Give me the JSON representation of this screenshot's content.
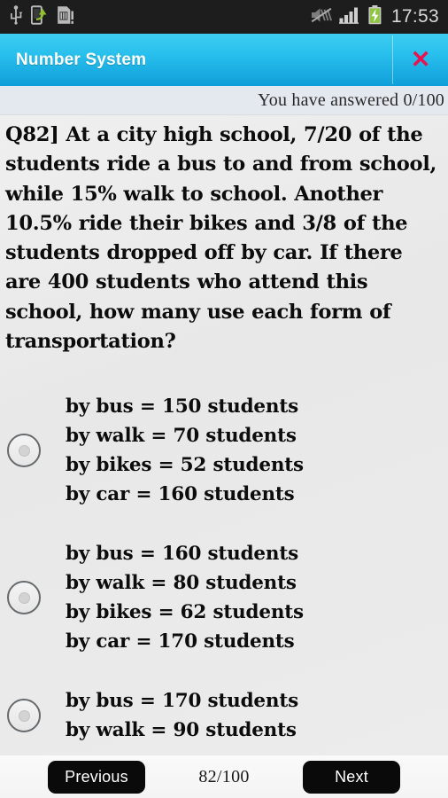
{
  "statusbar": {
    "time": "17:53",
    "icons": [
      {
        "name": "usb-icon"
      },
      {
        "name": "phone-transfer-icon"
      },
      {
        "name": "sd-card-alert-icon"
      },
      {
        "name": "mute-vibrate-off-icon"
      },
      {
        "name": "signal-bars-icon"
      },
      {
        "name": "battery-charging-icon"
      }
    ],
    "background_color": "#1d1d1d",
    "text_color": "#d8d8d8"
  },
  "titlebar": {
    "title": "Number System",
    "close_label": "✕",
    "gradient_from": "#3ecdf0",
    "gradient_to": "#0f9ed9",
    "title_color": "#ffffff",
    "close_color": "#e8134f"
  },
  "progress": {
    "answered_text": "You have answered 0/100",
    "answered_count": 0,
    "total_count": 100,
    "background_color": "#e4e8ef"
  },
  "question": {
    "number": "Q82]",
    "text": "Q82]  At a city high school, 7/20 of the students ride a bus to and from school, while 15% walk to school. Another 10.5% ride their bikes and 3/8 of the students dropped off by car. If there are 400 students who attend this school, how many use each form of transportation?"
  },
  "options": [
    {
      "id": "option-a",
      "selected": false,
      "text": "by bus =  150 students\nby walk = 70 students\nby bikes = 52 students\nby car = 160 students"
    },
    {
      "id": "option-b",
      "selected": false,
      "text": "by bus =  160 students\nby walk = 80 students\nby bikes = 62 students\nby car = 170 students"
    },
    {
      "id": "option-c",
      "selected": false,
      "text": "by bus =  170 students\nby walk = 90 students"
    }
  ],
  "bottombar": {
    "previous_label": "Previous",
    "next_label": "Next",
    "counter": "82/100",
    "current_question": 82,
    "total_questions": 100,
    "button_color": "#0a0a0a",
    "button_text_color": "#ffffff"
  }
}
